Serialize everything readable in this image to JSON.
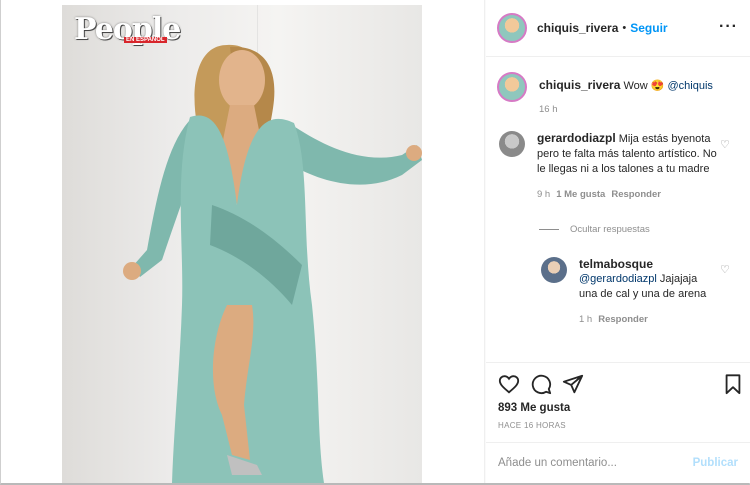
{
  "header": {
    "username": "chiquis_rivera",
    "separator": "•",
    "follow_label": "Seguir",
    "more_label": "···"
  },
  "photo": {
    "logo_text": "People",
    "logo_sub": "EN ESPAÑOL"
  },
  "caption": {
    "username": "chiquis_rivera",
    "text": "Wow 😍",
    "mention": "@chiquis",
    "time": "16 h"
  },
  "comments": [
    {
      "username": "gerardodiazpl",
      "text": "Mija estás byenota pero te falta más talento artístico. No le llegas ni a los talones a tu madre",
      "time": "9 h",
      "likes": "1 Me gusta",
      "reply_label": "Responder"
    }
  ],
  "hide_replies_label": "Ocultar respuestas",
  "reply": {
    "username": "telmabosque",
    "mention": "@gerardodiazpl",
    "text": "Jajajaja una de cal y una de arena",
    "time": "1 h",
    "reply_label": "Responder"
  },
  "actions": {
    "likes": "893 Me gusta",
    "timestamp": "HACE 16 HORAS"
  },
  "add_comment": {
    "placeholder": "Añade un comentario...",
    "post_label": "Publicar"
  },
  "colors": {
    "link_blue": "#0095f6",
    "post_disabled": "#b2dffc",
    "muted": "#8e8e8e"
  }
}
